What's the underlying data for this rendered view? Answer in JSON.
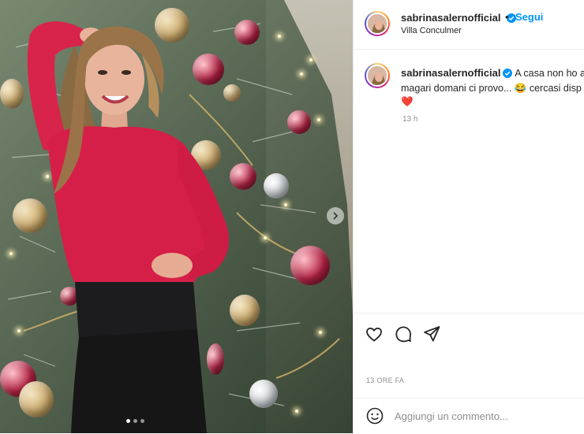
{
  "post": {
    "username": "sabrinasalernofficial",
    "follow_label": "Segui",
    "separator": "•",
    "location": "Villa Conculmer",
    "caption_username": "sabrinasalernofficial",
    "caption_line1": "A casa non ho anc",
    "caption_line2": "magari domani ci provo... 😂 cercasi disp",
    "caption_emoji": "❤️",
    "comment_time": "13 h",
    "post_age": "13 ORE FA",
    "comment_placeholder": "Aggiungi un commento...",
    "carousel": {
      "total_images": 3,
      "active_index": 0
    }
  },
  "icons": {
    "verified": "verified-badge-icon",
    "like": "heart-icon",
    "comment": "comment-bubble-icon",
    "share": "paper-plane-icon",
    "emoji": "emoji-smile-icon",
    "next": "chevron-right-icon"
  },
  "colors": {
    "link_blue": "#0095f6",
    "text": "#262626",
    "muted": "#8e8e8e",
    "heart_red": "#e0245e"
  }
}
